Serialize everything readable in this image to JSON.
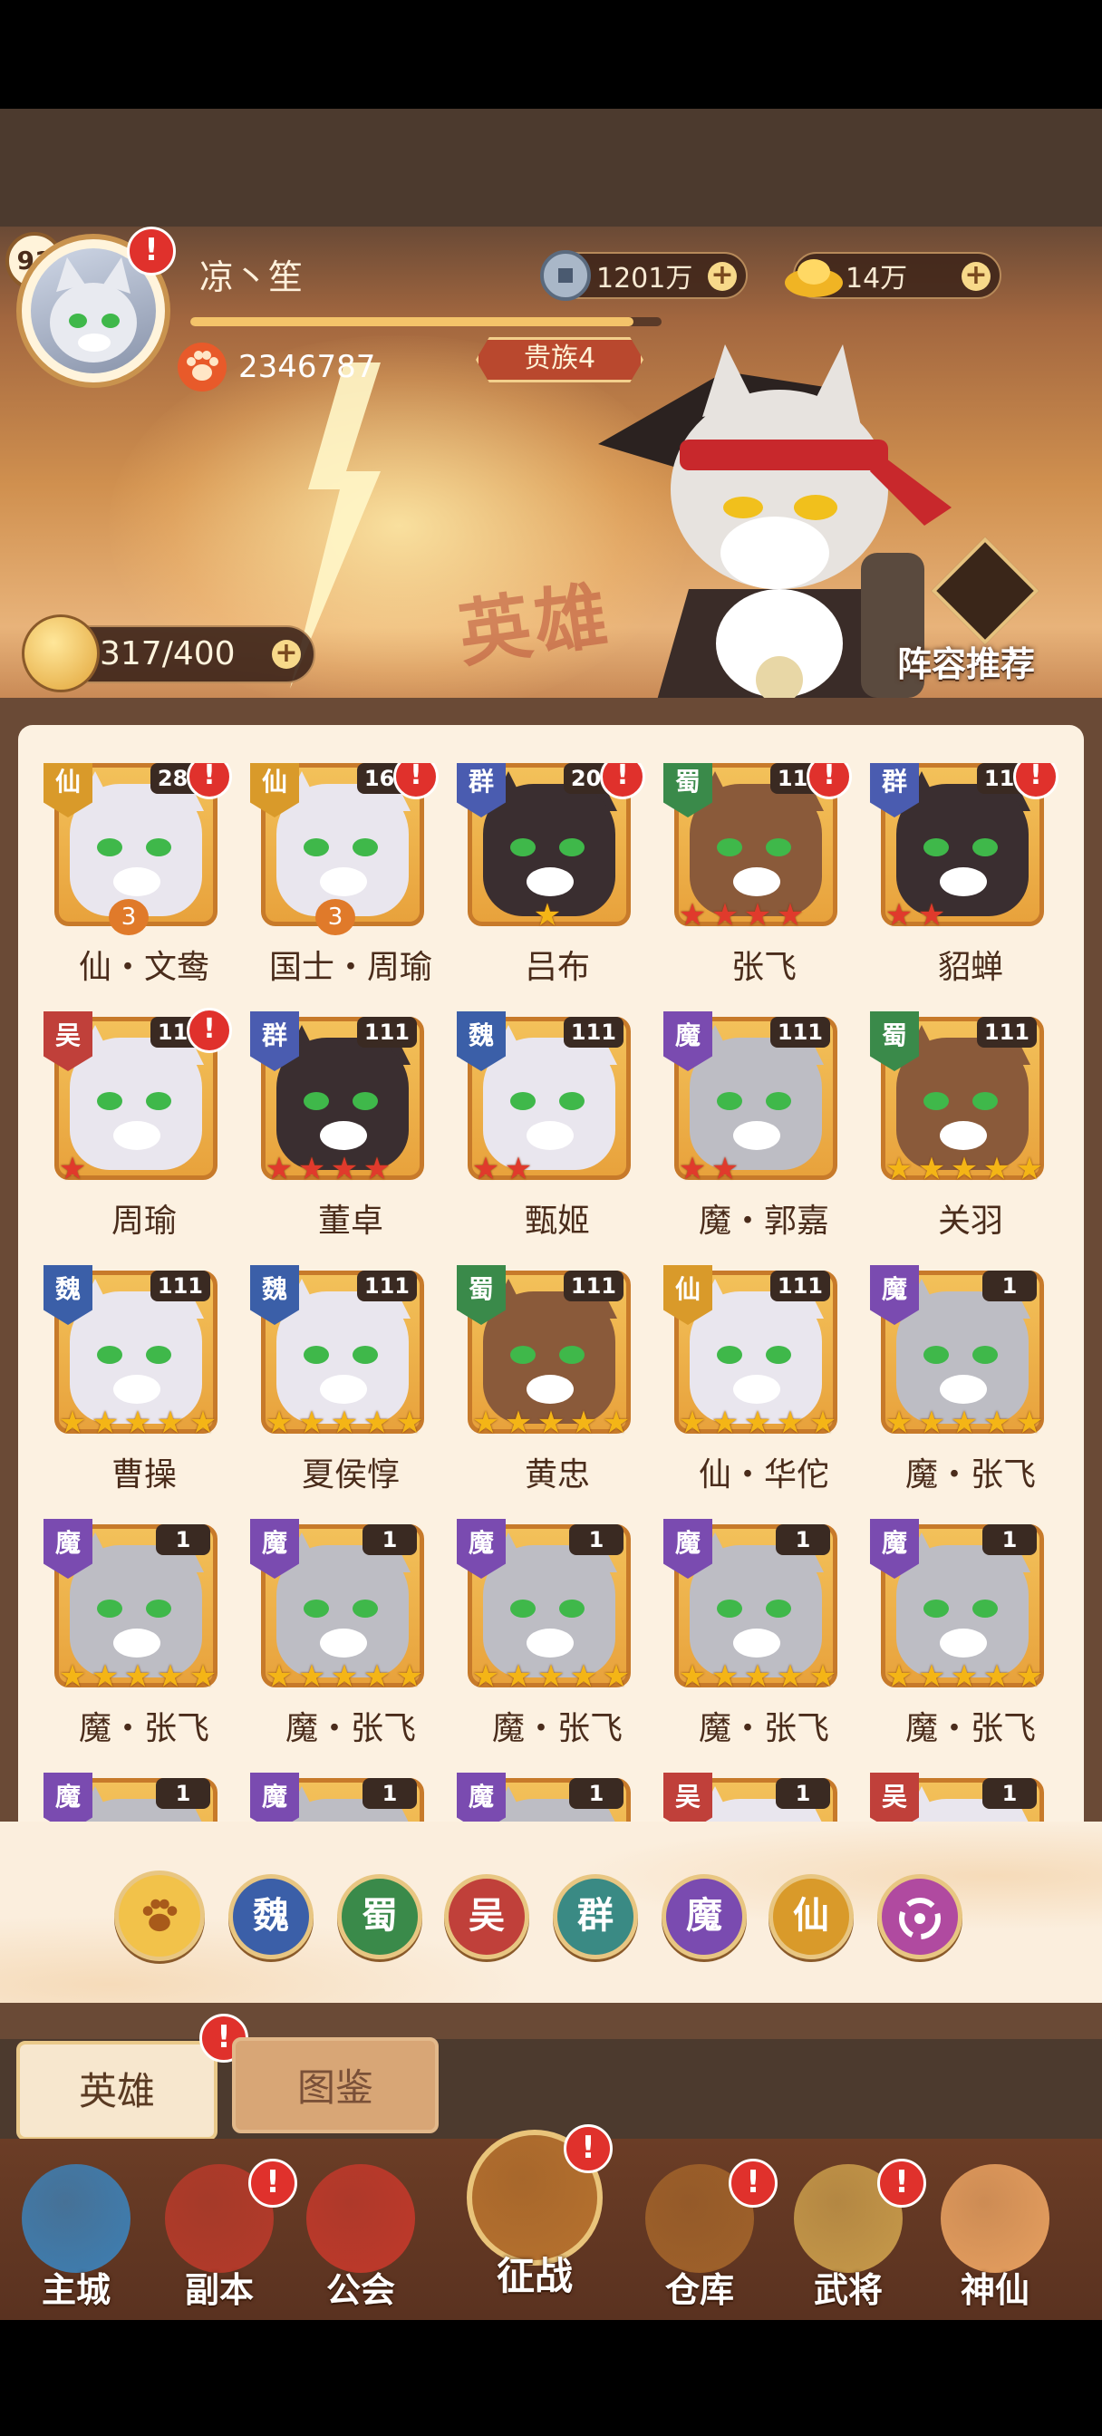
{
  "player": {
    "level": "91",
    "name": "凉丶笙",
    "power": "2346787",
    "noble": "贵族4",
    "xp_progress": 0.94
  },
  "currency": {
    "copper": "1201万",
    "gold": "14万"
  },
  "stamina": "317/400",
  "banner": {
    "title_art": "英雄",
    "recommend_label": "阵容推荐"
  },
  "colors": {
    "wei": "#3b5fa8",
    "shu": "#3a8a4a",
    "wu": "#c0403a",
    "qun": "#4a5cb0",
    "mo": "#7a4bb0",
    "xian": "#d99a2a",
    "accent": "#e0312c"
  },
  "heroes": [
    {
      "name": "仙・文鸯",
      "faction": "仙",
      "level": "280",
      "stars": "3",
      "star_type": "badge",
      "alert": true
    },
    {
      "name": "国士・周瑜",
      "faction": "仙",
      "level": "164",
      "stars": "3",
      "star_type": "badge",
      "alert": true
    },
    {
      "name": "吕布",
      "faction": "群",
      "level": "200",
      "stars": "1",
      "star_type": "gold",
      "alert": true
    },
    {
      "name": "张飞",
      "faction": "蜀",
      "level": "111",
      "stars": "4",
      "star_type": "red",
      "alert": true
    },
    {
      "name": "貂蝉",
      "faction": "群",
      "level": "111",
      "stars": "2",
      "star_type": "red",
      "alert": true
    },
    {
      "name": "周瑜",
      "faction": "吴",
      "level": "111",
      "stars": "1",
      "star_type": "red",
      "alert": true
    },
    {
      "name": "董卓",
      "faction": "群",
      "level": "111",
      "stars": "4",
      "star_type": "red",
      "alert": false
    },
    {
      "name": "甄姬",
      "faction": "魏",
      "level": "111",
      "stars": "2",
      "star_type": "red",
      "alert": false
    },
    {
      "name": "魔・郭嘉",
      "faction": "魔",
      "level": "111",
      "stars": "2",
      "star_type": "red",
      "alert": false
    },
    {
      "name": "关羽",
      "faction": "蜀",
      "level": "111",
      "stars": "5",
      "star_type": "gold",
      "alert": false
    },
    {
      "name": "曹操",
      "faction": "魏",
      "level": "111",
      "stars": "5",
      "star_type": "gold",
      "alert": false
    },
    {
      "name": "夏侯惇",
      "faction": "魏",
      "level": "111",
      "stars": "5",
      "star_type": "gold",
      "alert": false
    },
    {
      "name": "黄忠",
      "faction": "蜀",
      "level": "111",
      "stars": "5",
      "star_type": "gold",
      "alert": false
    },
    {
      "name": "仙・华佗",
      "faction": "仙",
      "level": "111",
      "stars": "5",
      "star_type": "gold",
      "alert": false
    },
    {
      "name": "魔・张飞",
      "faction": "魔",
      "level": "1",
      "stars": "5",
      "star_type": "gold",
      "alert": false
    },
    {
      "name": "魔・张飞",
      "faction": "魔",
      "level": "1",
      "stars": "5",
      "star_type": "gold",
      "alert": false
    },
    {
      "name": "魔・张飞",
      "faction": "魔",
      "level": "1",
      "stars": "5",
      "star_type": "gold",
      "alert": false
    },
    {
      "name": "魔・张飞",
      "faction": "魔",
      "level": "1",
      "stars": "5",
      "star_type": "gold",
      "alert": false
    },
    {
      "name": "魔・张飞",
      "faction": "魔",
      "level": "1",
      "stars": "5",
      "star_type": "gold",
      "alert": false
    },
    {
      "name": "魔・张飞",
      "faction": "魔",
      "level": "1",
      "stars": "5",
      "star_type": "gold",
      "alert": false
    },
    {
      "name": "",
      "faction": "魔",
      "level": "1",
      "stars": "0",
      "star_type": "gold",
      "alert": false
    },
    {
      "name": "",
      "faction": "魔",
      "level": "1",
      "stars": "0",
      "star_type": "gold",
      "alert": false
    },
    {
      "name": "",
      "faction": "魔",
      "level": "1",
      "stars": "0",
      "star_type": "gold",
      "alert": false
    },
    {
      "name": "",
      "faction": "吴",
      "level": "1",
      "stars": "0",
      "star_type": "gold",
      "alert": false
    },
    {
      "name": "",
      "faction": "吴",
      "level": "1",
      "stars": "0",
      "star_type": "gold",
      "alert": false
    }
  ],
  "filters": [
    "paw-icon",
    "魏",
    "蜀",
    "吴",
    "群",
    "魔",
    "仙",
    "swirl-icon"
  ],
  "tabs": {
    "heroes": "英雄",
    "codex": "图鉴"
  },
  "nav": [
    {
      "label": "主城",
      "icon": "castle-icon",
      "alert": false
    },
    {
      "label": "副本",
      "icon": "sword-icon",
      "alert": true
    },
    {
      "label": "公会",
      "icon": "flag-icon",
      "alert": false
    },
    {
      "label": "征战",
      "icon": "battle-icon",
      "alert": true
    },
    {
      "label": "仓库",
      "icon": "bag-icon",
      "alert": true
    },
    {
      "label": "武将",
      "icon": "general-icon",
      "alert": true
    },
    {
      "label": "神仙",
      "icon": "cat-icon",
      "alert": false
    }
  ],
  "alert_symbol": "!"
}
